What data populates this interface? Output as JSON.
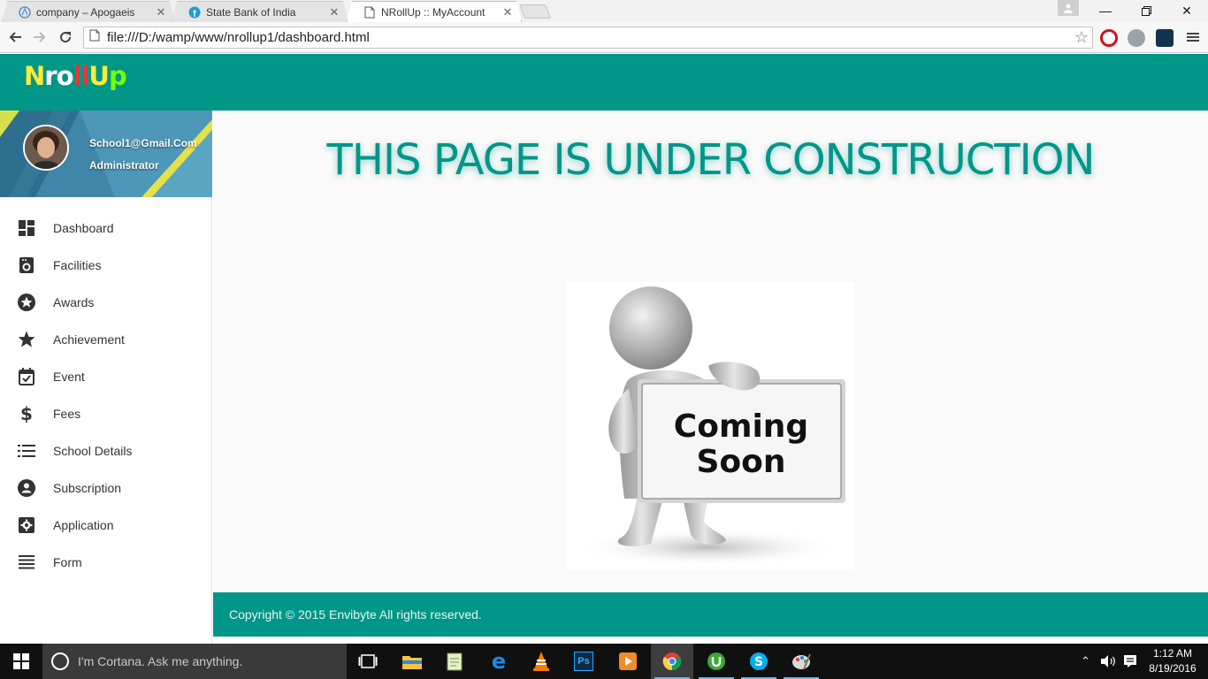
{
  "browser": {
    "tabs": [
      {
        "label": "company – Apogaeis"
      },
      {
        "label": "State Bank of India"
      },
      {
        "label": "NRollUp :: MyAccount"
      }
    ],
    "url": "file:///D:/wamp/www/nrollup1/dashboard.html"
  },
  "app": {
    "logo": [
      "N",
      "r",
      "o",
      "ll",
      "U",
      "p"
    ],
    "logo_colors": [
      "#ffeb3b",
      "#ffffff",
      "#ffffff",
      "#e53935",
      "#ffeb3b",
      "#76ff03"
    ]
  },
  "profile": {
    "email": "School1@Gmail.Com",
    "role": "Administrator"
  },
  "menu": [
    {
      "label": "Dashboard",
      "icon": "dashboard-icon"
    },
    {
      "label": "Facilities",
      "icon": "facilities-icon"
    },
    {
      "label": "Awards",
      "icon": "award-icon"
    },
    {
      "label": "Achievement",
      "icon": "star-icon"
    },
    {
      "label": "Event",
      "icon": "calendar-check-icon"
    },
    {
      "label": "Fees",
      "icon": "dollar-icon"
    },
    {
      "label": "School Details",
      "icon": "list-icon"
    },
    {
      "label": "Subscription",
      "icon": "account-circle-icon"
    },
    {
      "label": "Application",
      "icon": "settings-box-icon"
    },
    {
      "label": "Form",
      "icon": "lines-icon"
    }
  ],
  "main": {
    "headline": "THIS PAGE IS UNDER CONSTRUCTION",
    "sign_line1": "Coming",
    "sign_line2": "Soon"
  },
  "footer": {
    "copyright": "Copyright © 2015 Envibyte All rights reserved."
  },
  "taskbar": {
    "cortana": "I'm Cortana. Ask me anything.",
    "time": "1:12 AM",
    "date": "8/19/2016"
  },
  "colors": {
    "primary": "#009688",
    "footer_text": "#e6f5f3"
  }
}
